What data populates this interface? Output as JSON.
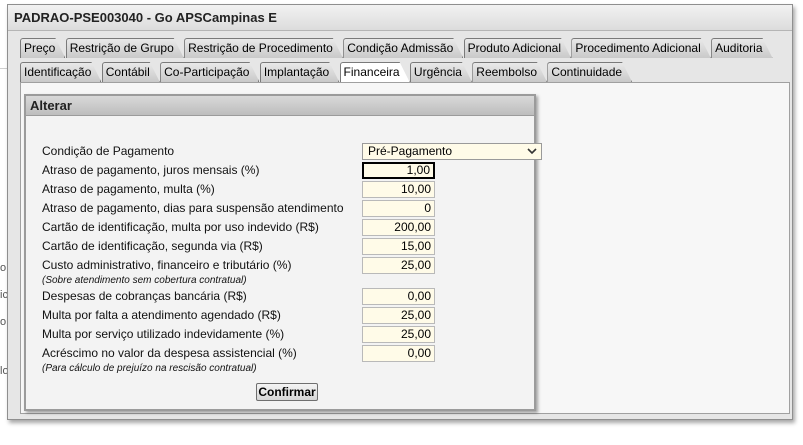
{
  "window": {
    "title": "PADRAO-PSE003040 - Go APSCampinas E"
  },
  "edge_fragments": [
    "o",
    "ic",
    "o",
    "lo"
  ],
  "tabs_row1": [
    "Preço",
    "Restrição de Grupo",
    "Restrição de Procedimento",
    "Condição Admissão",
    "Produto Adicional",
    "Procedimento Adicional",
    "Auditoria"
  ],
  "tabs_row2": [
    "Identificação",
    "Contábil",
    "Co-Participação",
    "Implantação",
    "Financeira",
    "Urgência",
    "Reembolso",
    "Continuidade"
  ],
  "active_tab": "Financeira",
  "dialog": {
    "title": "Alterar",
    "condicao_pagamento": {
      "label": "Condição de Pagamento",
      "value": "Pré-Pagamento",
      "icon": "chevron-down-icon"
    },
    "fields": [
      {
        "label": "Atraso de pagamento, juros mensais (%)",
        "value": "1,00"
      },
      {
        "label": "Atraso de pagamento, multa (%)",
        "value": "10,00"
      },
      {
        "label": "Atraso de pagamento, dias para suspensão atendimento",
        "value": "0"
      },
      {
        "label": "Cartão de identificação, multa por uso indevido (R$)",
        "value": "200,00"
      },
      {
        "label": "Cartão de identificação, segunda via (R$)",
        "value": "15,00"
      },
      {
        "label": "Custo administrativo, financeiro e tributário (%)",
        "value": "25,00"
      },
      {
        "label": "Despesas de cobranças bancária (R$)",
        "value": "0,00"
      },
      {
        "label": "Multa por falta a atendimento agendado (R$)",
        "value": "25,00"
      },
      {
        "label": "Multa por serviço utilizado indevidamente (%)",
        "value": "25,00"
      },
      {
        "label": "Acréscimo no valor da despesa assistencial (%)",
        "value": "0,00"
      }
    ],
    "note_custo": "(Sobre atendimento sem cobertura contratual)",
    "note_acrescimo": "(Para cálculo de prejuízo na rescisão contratual)",
    "confirm_label": "Confirmar"
  }
}
